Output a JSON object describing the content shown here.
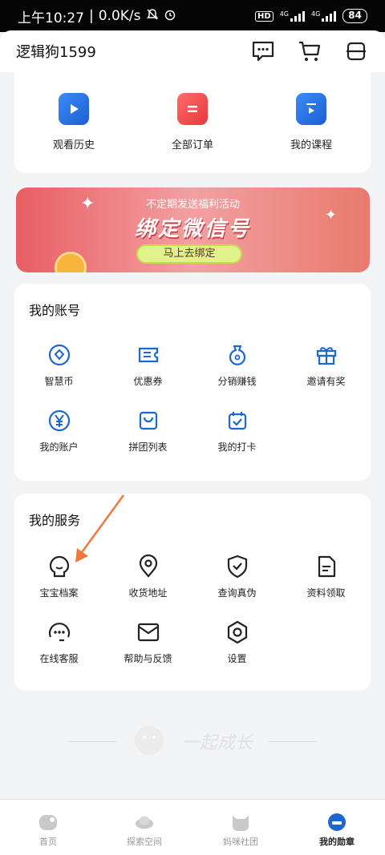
{
  "status_bar": {
    "time": "上午10:27",
    "speed": "0.0K/s",
    "hd": "HD",
    "net1": "4G",
    "net2": "4G",
    "battery": "84"
  },
  "header": {
    "username": "逻辑狗1599",
    "icons": [
      "message-icon",
      "cart-icon",
      "menu-icon"
    ]
  },
  "shortcuts": [
    {
      "label": "观看历史",
      "icon": "play-history-icon",
      "color": "#2f6fe4"
    },
    {
      "label": "全部订单",
      "icon": "order-icon",
      "color": "#ef4a4a"
    },
    {
      "label": "我的课程",
      "icon": "course-icon",
      "color": "#2f6fe4"
    }
  ],
  "banner": {
    "subtitle": "不定期发送福利活动",
    "title": "绑定微信号",
    "button": "马上去绑定"
  },
  "account": {
    "title": "我的账号",
    "items": [
      {
        "label": "智慧币",
        "icon": "coin-icon"
      },
      {
        "label": "优惠券",
        "icon": "coupon-icon"
      },
      {
        "label": "分销赚钱",
        "icon": "money-bag-icon"
      },
      {
        "label": "邀请有奖",
        "icon": "gift-icon"
      },
      {
        "label": "我的账户",
        "icon": "yuan-icon"
      },
      {
        "label": "拼团列表",
        "icon": "shopping-bag-icon"
      },
      {
        "label": "我的打卡",
        "icon": "calendar-check-icon"
      }
    ]
  },
  "services": {
    "title": "我的服务",
    "items": [
      {
        "label": "宝宝档案",
        "icon": "baby-icon"
      },
      {
        "label": "收货地址",
        "icon": "location-icon"
      },
      {
        "label": "查询真伪",
        "icon": "shield-check-icon"
      },
      {
        "label": "资料领取",
        "icon": "document-icon"
      },
      {
        "label": "在线客服",
        "icon": "customer-service-icon"
      },
      {
        "label": "帮助与反馈",
        "icon": "mail-icon"
      },
      {
        "label": "设置",
        "icon": "settings-icon"
      }
    ]
  },
  "slogan": "一起成长",
  "bottom_nav": [
    {
      "label": "首页",
      "icon": "home-icon",
      "active": false
    },
    {
      "label": "探索空间",
      "icon": "explore-icon",
      "active": false
    },
    {
      "label": "妈咪社团",
      "icon": "community-icon",
      "active": false
    },
    {
      "label": "我的勋章",
      "icon": "medal-icon",
      "active": true
    }
  ],
  "colors": {
    "accent_blue": "#1e66d0",
    "accent_red": "#ef4a4a",
    "annotation_arrow": "#f0783c"
  }
}
